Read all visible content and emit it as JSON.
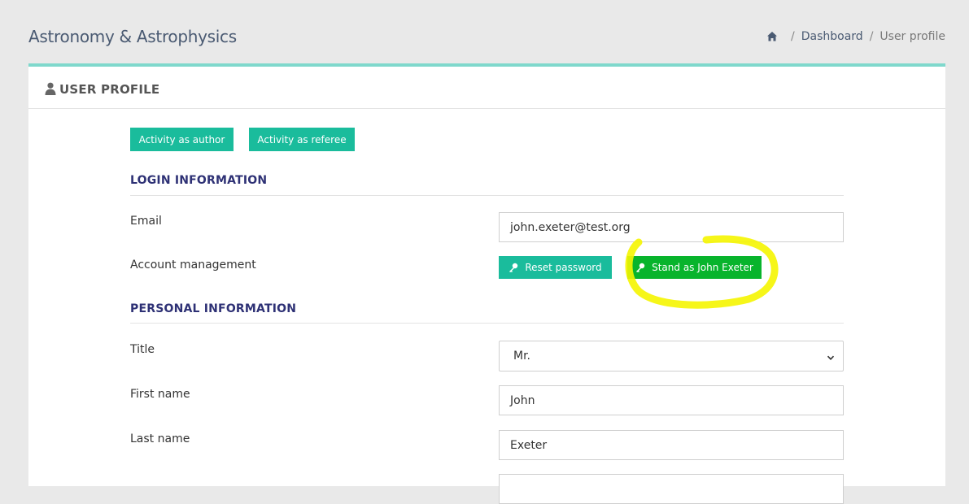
{
  "app": {
    "title": "Astronomy & Astrophysics"
  },
  "breadcrumb": {
    "home_icon": "home-icon",
    "separator": "/",
    "items": [
      "Dashboard",
      "User profile"
    ]
  },
  "card": {
    "title": "USER PROFILE",
    "title_icon": "user-icon"
  },
  "actions": {
    "activity_author": "Activity as author",
    "activity_referee": "Activity as referee"
  },
  "login": {
    "section_title": "LOGIN INFORMATION",
    "email_label": "Email",
    "email_value": "john.exeter@test.org",
    "account_label": "Account management",
    "reset_password": "Reset password",
    "stand_as": "Stand as John Exeter"
  },
  "personal": {
    "section_title": "PERSONAL INFORMATION",
    "title_label": "Title",
    "title_value": "Mr.",
    "first_name_label": "First name",
    "first_name_value": "John",
    "last_name_label": "Last name",
    "last_name_value": "Exeter"
  },
  "colors": {
    "accent": "#1abc9c",
    "section_title": "#2e3175",
    "card_top_border": "#7fd8cc",
    "highlight_annotation": "#f5f500"
  }
}
